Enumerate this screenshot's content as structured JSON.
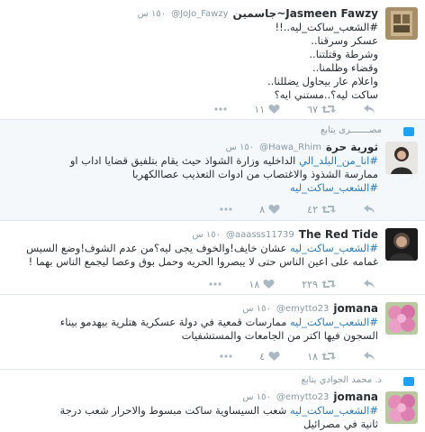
{
  "tweets": [
    {
      "name": "Jasmeen Fawzy~جاسمين",
      "handle": "@JoJo_Fawzy",
      "time": "١٥٠ س",
      "body": "#الشعب_ساكت_ليه..!!\nعسكر وسرقنا..\nوشرطة وقتلتنا..\nوقضاء وظلمنا..\nواعلام عار بيحاول يضللنا..\nساكت ليه؟..مستني ايه؟",
      "replies": "",
      "retweets": "٦٧",
      "likes": "١١"
    },
    {
      "retweeted_by": "مصـــــــرى يتابع",
      "name": "ثورية حرة",
      "handle": "@Hawa_Rhim",
      "time": "١٥٠ س",
      "hashtag_inline": "#انا_من_البلد_الي",
      "body_rest": " الداخليه وزارة الشواذ حيث يقام بتلفيق قضايا اداب او ممارسة الشذوذ والاغتصاب من ادوات التعذيب عصاالكهربا",
      "hashtag_end": "#الشعب_ساكت_ليه",
      "replies": "",
      "retweets": "٤٢",
      "likes": "٨"
    },
    {
      "name": "The Red Tide",
      "handle": "@aaasss11739",
      "time": "١٥٠ س",
      "hashtag": "#الشعب_ساكت_ليه",
      "body_rest": " عشان خايف!والخوف يجى ليه؟من عدم الشوف!وضع السيس غمامه على اعين الناس حتى لا يبصروا الحريه وحمل بوق وعصا ليجمع الناس بهما !",
      "replies": "",
      "retweets": "٢٢٩",
      "likes": "١٨"
    },
    {
      "name": "jomana",
      "handle": "@emytto23",
      "time": "١٥٠ س",
      "hashtag": "#الشعب_ساكت_ليه",
      "body_rest": " ممارسات قمعية في دولة عسكرية هتلرية بيهدمو بيناء السجون فيها اكتر من الجامعات والمستشفيات",
      "replies": "",
      "retweets": "١٨",
      "likes": "٤"
    },
    {
      "retweeted_by": "د. محمد الجوادي يتابع",
      "name": "jomana",
      "handle": "@emytto23",
      "time": "١٥٠ س",
      "hashtag": "#الشعب_ساكت_ليه",
      "body_rest": " شعب السيساوية ساكت مبسوط والاحرار شعب درجة ثانية في مصرائيل",
      "replies": "",
      "retweets": "",
      "likes": ""
    }
  ]
}
